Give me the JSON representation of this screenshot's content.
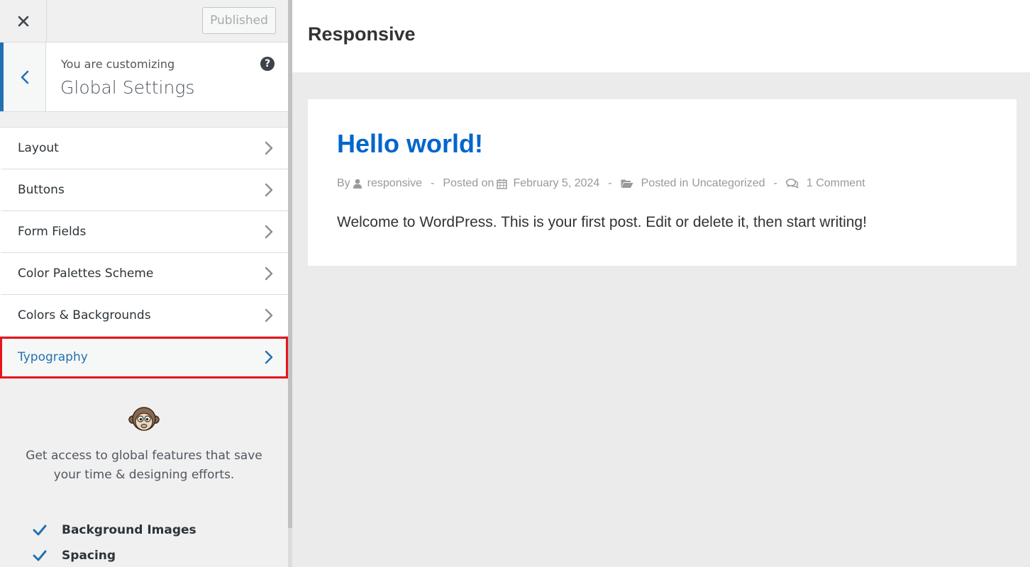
{
  "topbar": {
    "close_icon": "close-icon",
    "publish_label": "Published"
  },
  "section": {
    "customizing_label": "You are customizing",
    "title": "Global Settings",
    "help_glyph": "?"
  },
  "menu": {
    "items": [
      {
        "label": "Layout"
      },
      {
        "label": "Buttons"
      },
      {
        "label": "Form Fields"
      },
      {
        "label": "Color Palettes Scheme"
      },
      {
        "label": "Colors & Backgrounds"
      },
      {
        "label": "Typography",
        "active": true
      }
    ]
  },
  "promo": {
    "text": "Get access to global features that save your time & designing efforts.",
    "features": [
      "Background Images",
      "Spacing"
    ]
  },
  "preview": {
    "site_title": "Responsive",
    "post": {
      "title": "Hello world!",
      "by_label": "By",
      "author": "responsive",
      "separator": "-",
      "posted_on_label": "Posted on",
      "date": "February 5, 2024",
      "posted_in_label": "Posted in",
      "category": "Uncategorized",
      "comments": "1 Comment",
      "excerpt": "Welcome to WordPress. This is your first post. Edit or delete it, then start writing!"
    }
  },
  "colors": {
    "accent": "#2271b1",
    "highlight": "#e8141c",
    "link": "#0066cc"
  }
}
